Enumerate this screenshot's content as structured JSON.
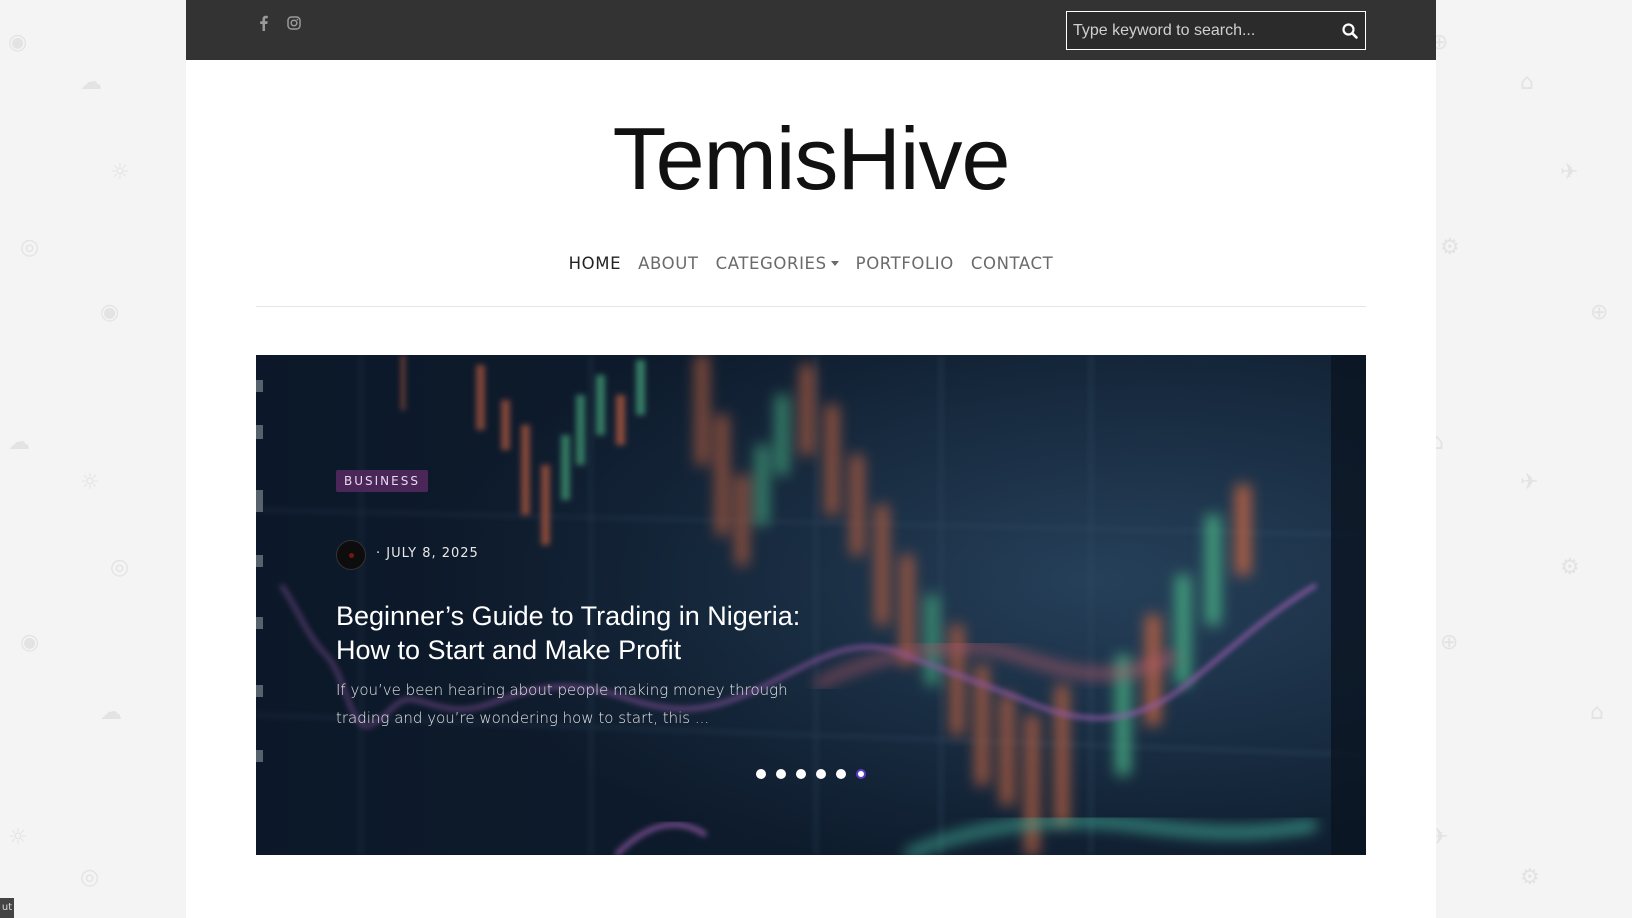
{
  "topbar": {
    "social": [
      {
        "icon": "facebook-icon"
      },
      {
        "icon": "instagram-icon"
      }
    ],
    "search": {
      "placeholder": "Type keyword to search...",
      "icon": "search-icon"
    }
  },
  "site": {
    "title": "TemisHive"
  },
  "nav": {
    "items": [
      {
        "label": "HOME",
        "active": true
      },
      {
        "label": "ABOUT",
        "active": false
      },
      {
        "label": "CATEGORIES",
        "active": false,
        "dropdown": true
      },
      {
        "label": "PORTFOLIO",
        "active": false
      },
      {
        "label": "CONTACT",
        "active": false
      }
    ]
  },
  "hero": {
    "category": "BUSINESS",
    "date": "· JULY 8, 2025",
    "title": "Beginner’s Guide to Trading in Nigeria: How to Start and Make Profit",
    "excerpt": "If you’ve been hearing about people making money through trading and you’re wondering how to start, this ...",
    "slides": 6,
    "active_slide": 6
  },
  "corner_tag": "ut",
  "colors": {
    "topbar": "#333333",
    "badge": "#4a2758",
    "active_dot_ring": "#5b3cc4",
    "hero_bg": "#16293d"
  }
}
